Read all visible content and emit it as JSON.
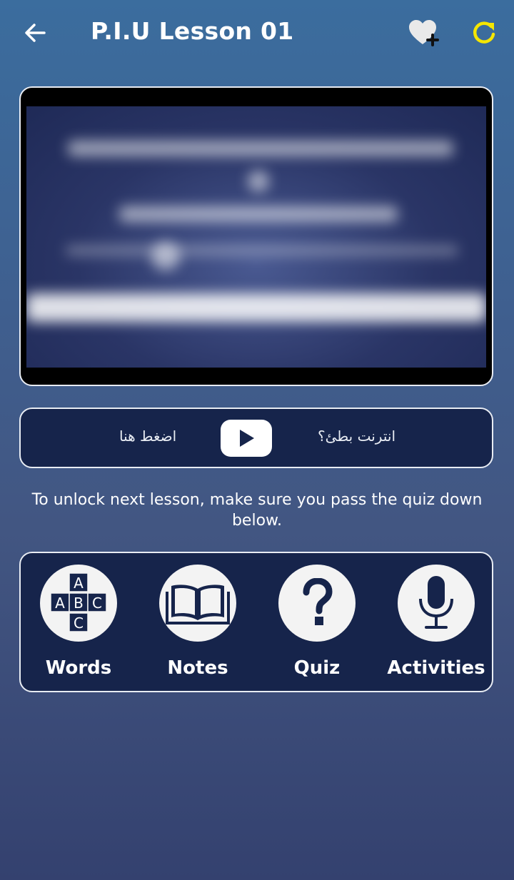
{
  "header": {
    "title": "P.I.U Lesson 01",
    "back_icon": "back-arrow-icon",
    "favorite_icon": "heart-plus-icon",
    "refresh_icon": "refresh-icon",
    "refresh_color": "#f5e600"
  },
  "video": {
    "state": "blurred-preview"
  },
  "slow_internet": {
    "question": "انترنت بطئ؟",
    "action": "اضغط هنا",
    "play_icon": "play-icon"
  },
  "notice": "To unlock next lesson, make sure you pass the quiz down below.",
  "tools": [
    {
      "label": "Words",
      "icon": "abc-blocks-icon"
    },
    {
      "label": "Notes",
      "icon": "open-book-icon"
    },
    {
      "label": "Quiz",
      "icon": "question-mark-icon"
    },
    {
      "label": "Activities",
      "icon": "microphone-icon"
    }
  ],
  "colors": {
    "card_bg": "#16244b",
    "card_border": "#e8ecf3",
    "bg_top": "#3b6d9e",
    "bg_bottom": "#34416f"
  }
}
